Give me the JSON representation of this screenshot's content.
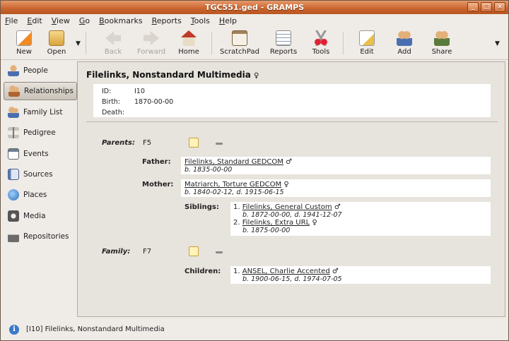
{
  "window": {
    "title": "TGC551.ged - GRAMPS",
    "min": "_",
    "max": "□",
    "close": "×"
  },
  "menu": [
    "File",
    "Edit",
    "View",
    "Go",
    "Bookmarks",
    "Reports",
    "Tools",
    "Help"
  ],
  "toolbar": {
    "new": "New",
    "open": "Open",
    "back": "Back",
    "forward": "Forward",
    "home": "Home",
    "scratchpad": "ScratchPad",
    "reports": "Reports",
    "tools": "Tools",
    "edit": "Edit",
    "add": "Add",
    "share": "Share"
  },
  "sidebar": [
    "People",
    "Relationships",
    "Family List",
    "Pedigree",
    "Events",
    "Sources",
    "Places",
    "Media",
    "Repositories"
  ],
  "person": {
    "name": "Filelinks, Nonstandard Multimedia",
    "gender": "♀",
    "id_label": "ID:",
    "id": "I10",
    "birth_label": "Birth:",
    "birth": "1870-00-00",
    "death_label": "Death:",
    "death": ""
  },
  "parents": {
    "label": "Parents:",
    "id": "F5",
    "father_label": "Father:",
    "father_name": "Filelinks, Standard GEDCOM",
    "father_gender": "♂",
    "father_dates": "b. 1835-00-00",
    "mother_label": "Mother:",
    "mother_name": "Matriarch, Torture GEDCOM",
    "mother_gender": "♀",
    "mother_dates": "b. 1840-02-12, d. 1915-06-15",
    "siblings_label": "Siblings:",
    "sib1_num": "1.",
    "sib1_name": "Filelinks, General Custom",
    "sib1_gender": "♂",
    "sib1_dates": "b. 1872-00-00, d. 1941-12-07",
    "sib2_num": "2.",
    "sib2_name": "Filelinks, Extra URL",
    "sib2_gender": "♀",
    "sib2_dates": "b. 1875-00-00"
  },
  "family": {
    "label": "Family:",
    "id": "F7",
    "children_label": "Children:",
    "child1_num": "1.",
    "child1_name": "ANSEL, Charlie Accented",
    "child1_gender": "♂",
    "child1_dates": "b. 1900-06-15, d. 1974-07-05"
  },
  "status": {
    "icon": "i",
    "text": "[I10] Filelinks, Nonstandard Multimedia"
  }
}
